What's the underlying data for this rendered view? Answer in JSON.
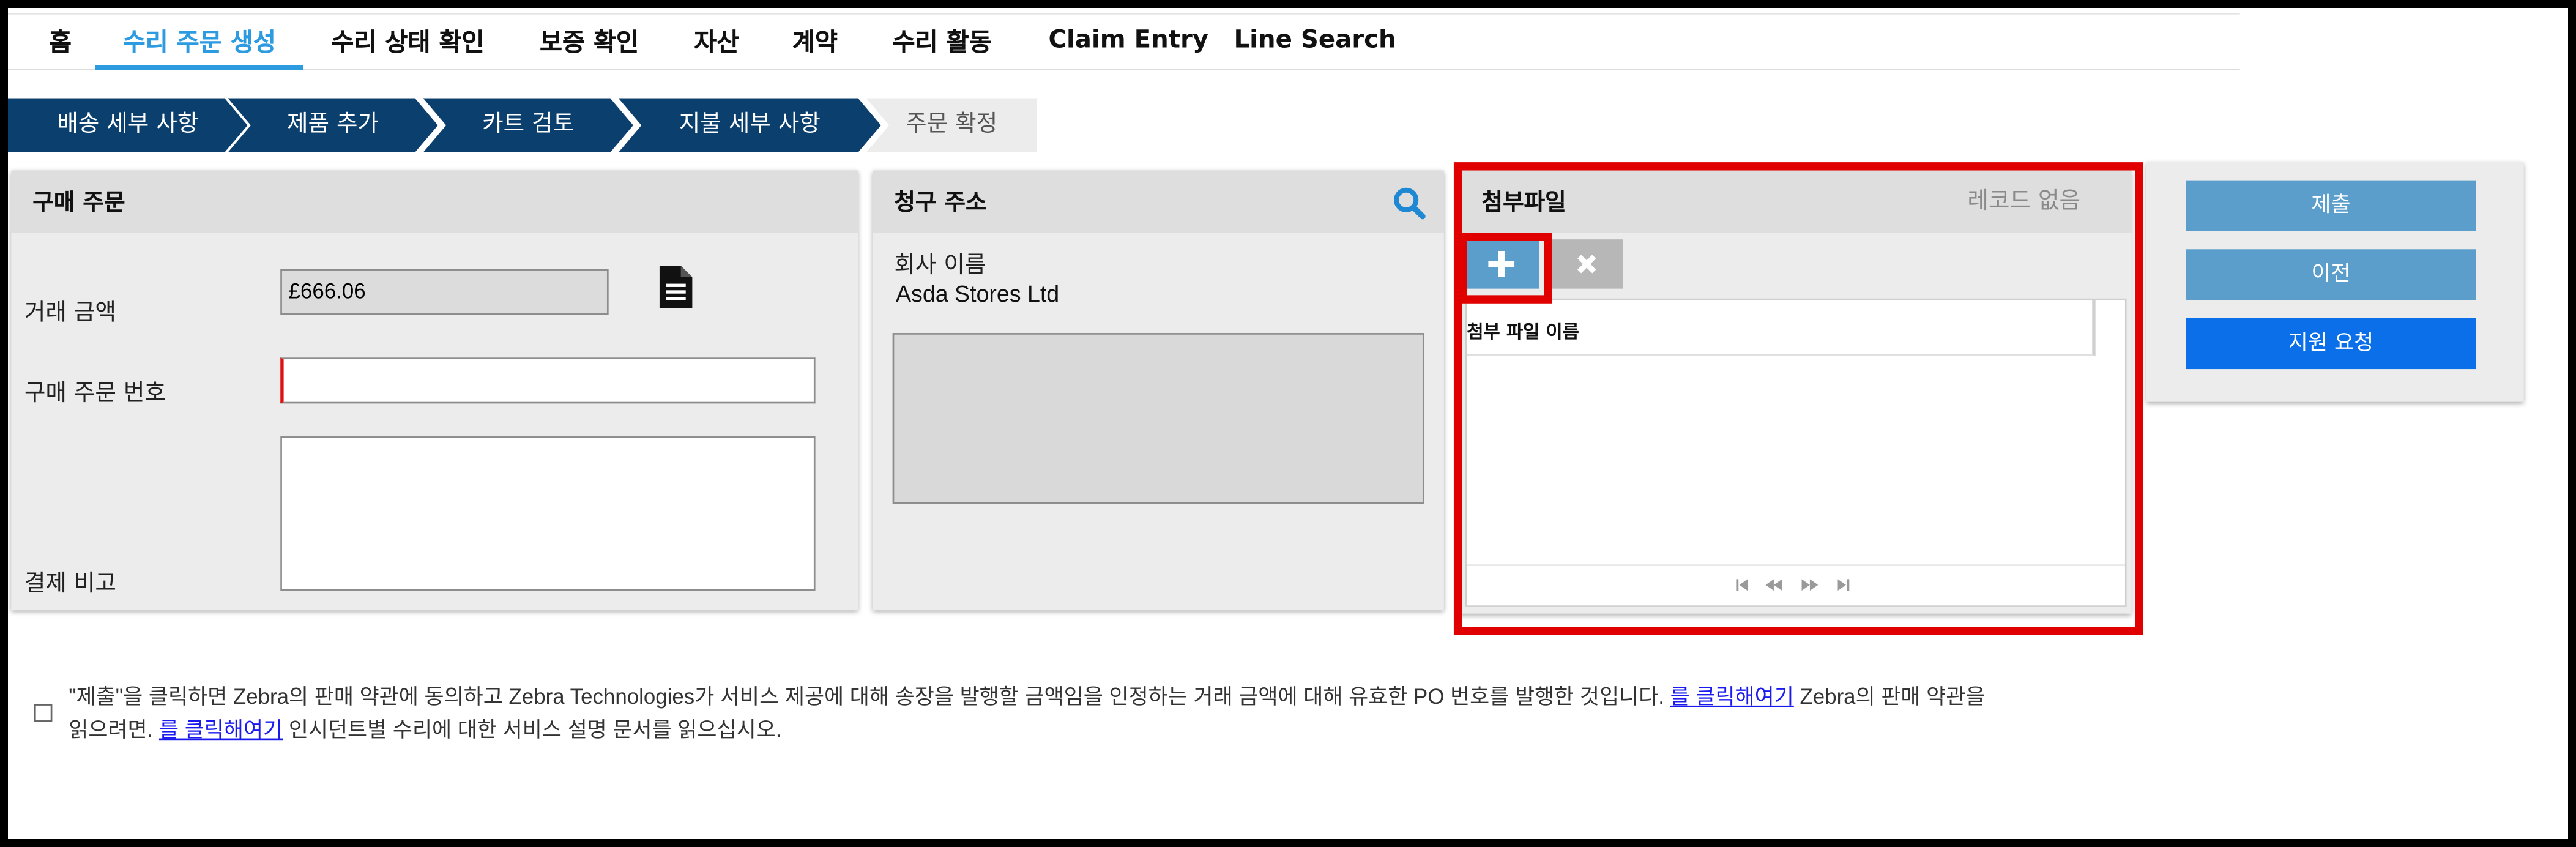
{
  "nav": {
    "items": [
      "홈",
      "수리 주문 생성",
      "수리 상태 확인",
      "보증 확인",
      "자산",
      "계약",
      "수리 활동",
      "Claim Entry",
      "Line Search"
    ],
    "active_index": 1
  },
  "steps": [
    "배송 세부 사항",
    "제품 추가",
    "카트 검토",
    "지불 세부 사항",
    "주문 확정"
  ],
  "purchase_order": {
    "title": "구매 주문",
    "amount_label": "거래 금액",
    "amount_value": "£666.06",
    "po_number_label": "구매 주문 번호",
    "po_number_value": "",
    "notes_label": "결제 비고",
    "notes_value": ""
  },
  "billing": {
    "title": "청구 주소",
    "company_label": "회사 이름",
    "company_value": "Asda Stores Ltd",
    "address_value": ""
  },
  "attachments": {
    "title": "첨부파일",
    "status": "레코드 없음",
    "column_header": "첨부 파일 이름"
  },
  "actions": {
    "submit": "제출",
    "previous": "이전",
    "support": "지원 요청"
  },
  "terms": {
    "text1": "\"제출\"을 클릭하면 Zebra의 판매 약관에 동의하고 Zebra Technologies가 서비스 제공에 대해 송장을 발행할 금액임을 인정하는 거래 금액에 대해 유효한 PO 번호를 발행한 것입니다. ",
    "link1": "를 클릭해여기",
    "text2": " Zebra의 판매 약관을",
    "text3": "읽으려면. ",
    "link2": "를 클릭해여기",
    "text4": " 인시던트별 수리에 대한 서비스 설명 문서를 읽으십시오."
  },
  "colors": {
    "nav_active": "#2d9be0",
    "step_dark": "#0b3f6e",
    "button_muted": "#5b9ecb",
    "button_primary": "#0a6fe8",
    "highlight": "#e00000"
  }
}
